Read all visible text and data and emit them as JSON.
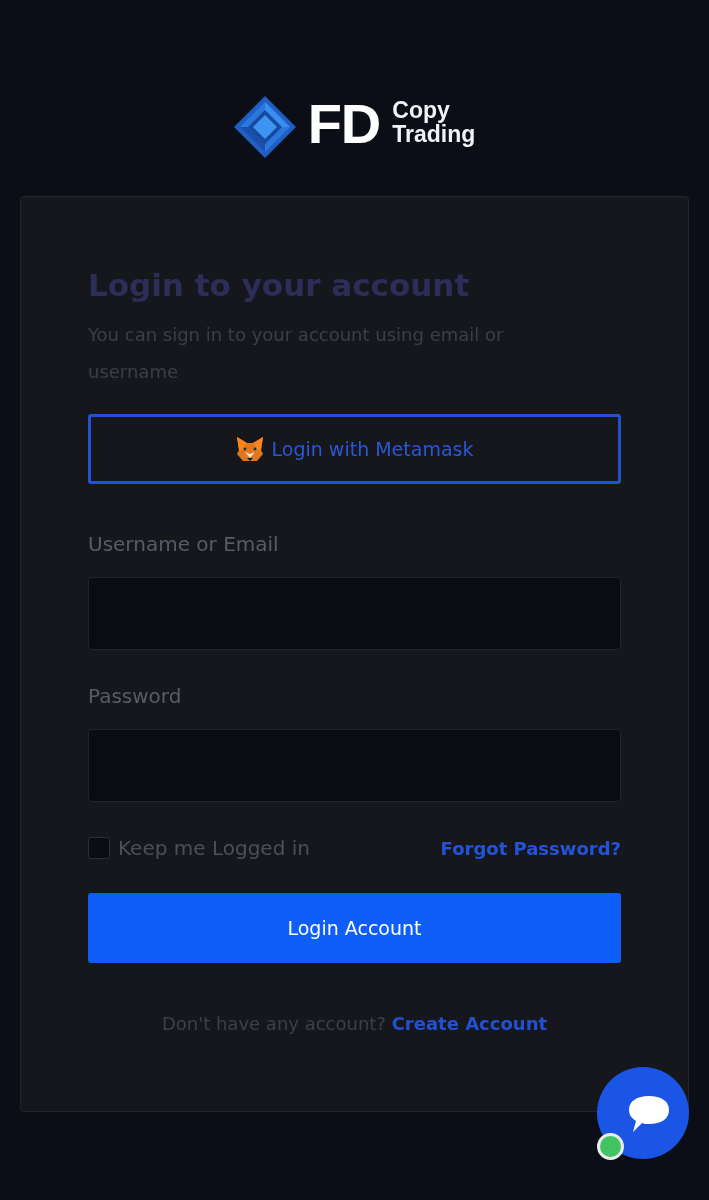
{
  "logo": {
    "initials": "FD",
    "line_1": "Copy",
    "line_2": "Trading"
  },
  "login": {
    "title": "Login to your account",
    "subtitle": "You can sign in to your account using email or username",
    "metamask_button": "Login with Metamask",
    "fields": [
      {
        "label": "Username or Email"
      },
      {
        "label": "Password"
      }
    ],
    "remember": {
      "label": "Keep me Logged in",
      "checked": false
    },
    "forgot_link": "Forgot Password?",
    "submit_button": "Login Account",
    "signup_prompt": "Don't have any account?",
    "signup_link": "Create Account"
  },
  "chat": {
    "online": true
  }
}
